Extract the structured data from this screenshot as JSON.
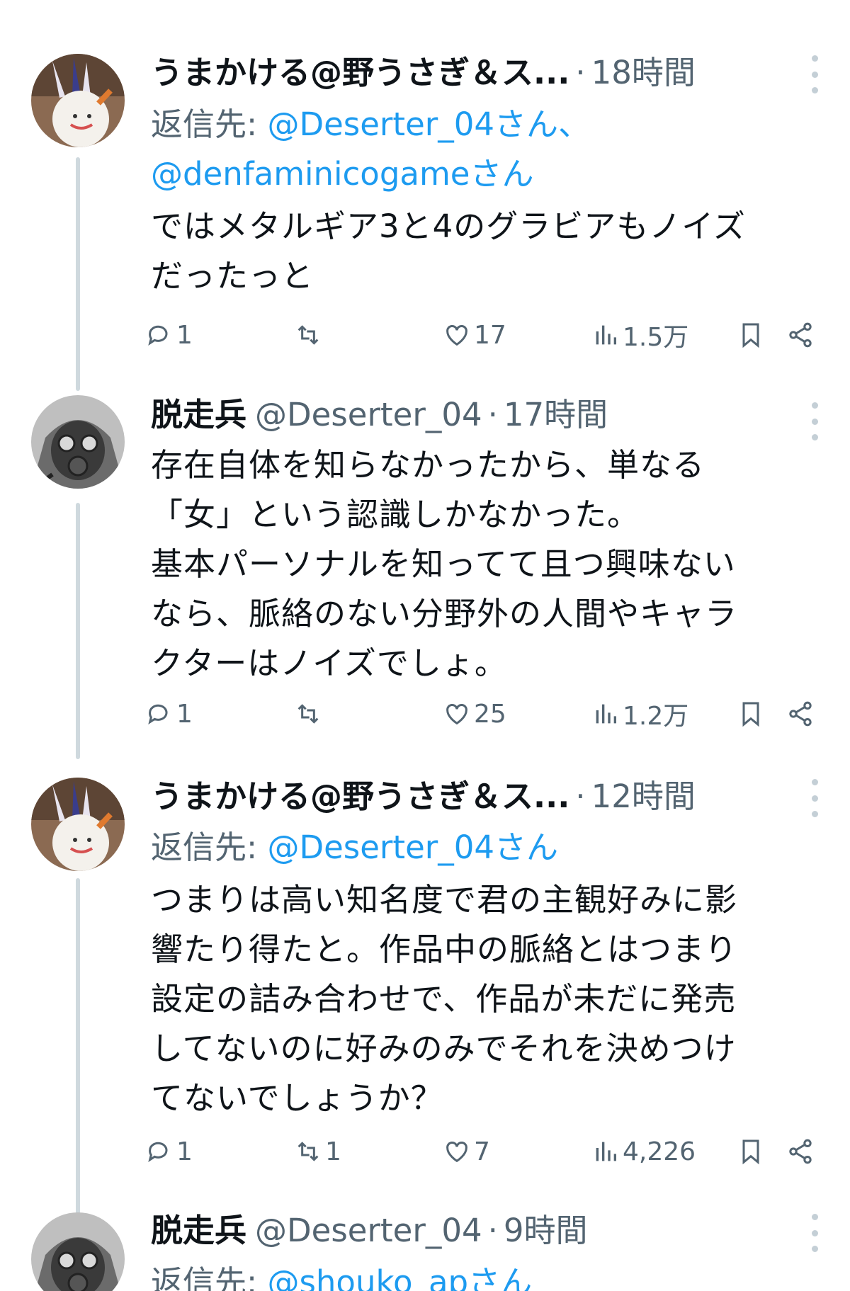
{
  "tweets": [
    {
      "name": "うまかける@野うさぎ＆ス...",
      "handle": "",
      "sep": "·",
      "time": "18時間",
      "reply_prefix": "返信先: ",
      "reply_line1": "@Deserter_04さん、",
      "reply_line2": "@denfaminicogameさん",
      "text": "ではメタルギア3と4のグラビアもノイズ\nだったっと",
      "replies": "1",
      "retweets": "",
      "likes": "17",
      "views": "1.5万"
    },
    {
      "name": "脱走兵",
      "handle": "@Deserter_04",
      "sep": "·",
      "time": "17時間",
      "text": "存在自体を知らなかったから、単なる\n「女」という認識しかなかった。\n基本パーソナルを知ってて且つ興味ない\nなら、脈絡のない分野外の人間やキャラ\nクターはノイズでしょ。",
      "replies": "1",
      "retweets": "",
      "likes": "25",
      "views": "1.2万"
    },
    {
      "name": "うまかける@野うさぎ＆ス...",
      "handle": "",
      "sep": "·",
      "time": "12時間",
      "reply_prefix": "返信先: ",
      "reply_line1": "@Deserter_04さん",
      "text": "つまりは高い知名度で君の主観好みに影\n響たり得たと。作品中の脈絡とはつまり\n設定の詰み合わせで、作品が未だに発売\nしてないのに好みのみでそれを決めつけ\nてないでしょうか？",
      "replies": "1",
      "retweets": "1",
      "likes": "7",
      "views": "4,226"
    },
    {
      "name": "脱走兵",
      "handle": "@Deserter_04",
      "sep": "·",
      "time": "9時間",
      "reply_prefix": "返信先: ",
      "reply_line1": "@shouko_apさん"
    }
  ],
  "colors": {
    "text": "#0f1419",
    "secondary": "#536471",
    "link": "#1d9bf0",
    "thread_line": "#cfd9de"
  },
  "icons": [
    "reply-icon",
    "retweet-icon",
    "like-icon",
    "views-icon",
    "bookmark-icon",
    "share-icon",
    "more-icon"
  ]
}
